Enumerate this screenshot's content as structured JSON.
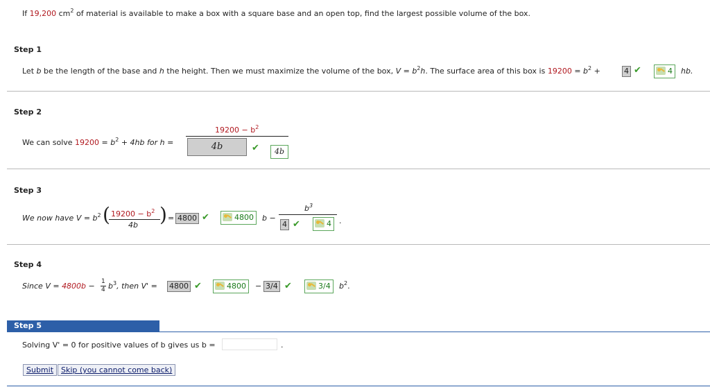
{
  "question": {
    "pre": "If ",
    "amount": "19,200",
    "unit": " cm",
    "unit_exp": "2",
    "post": " of material is available to make a box with a square base and an open top, find the largest possible volume of the box."
  },
  "step1": {
    "label": "Step 1",
    "text_a": "Let ",
    "var_b": "b",
    "text_b": " be the length of the base and ",
    "var_h": "h",
    "text_c": " the height. Then we must maximize the volume of the box, ",
    "volume_eq": "V = b",
    "volume_exp": "2",
    "volume_h": "h",
    "text_d": ". The surface area of this box is ",
    "area_eq": "19200",
    "area_mid": " = b",
    "area_exp": "2",
    "area_plus": " +",
    "answer_box": "4",
    "key_value": "4",
    "tail": "hb."
  },
  "step2": {
    "label": "Step 2",
    "text_a": "We can solve ",
    "eq_lhs": "19200",
    "eq_rest": " = b",
    "eq_exp": "2",
    "eq_tail": " + 4hb  for  h = ",
    "num": "19200 − b",
    "num_exp": "2",
    "answer_box": "4b",
    "key_value": "4b"
  },
  "step3": {
    "label": "Step 3",
    "text_a": "We now have  V = b",
    "exp_a": "2",
    "inner_num": "19200 − b",
    "inner_exp": "2",
    "inner_den": "4b",
    "equals": "=",
    "box_a": "4800",
    "key_a": "4800",
    "b_minus": "b −",
    "frac_num": "b",
    "frac_num_exp": "3",
    "box_b": "4",
    "key_b": "4",
    "period": "."
  },
  "step4": {
    "label": "Step 4",
    "text_a": "Since  V = ",
    "v_expr": "4800b",
    "minus": " −",
    "frac_n": "1",
    "frac_d": "4",
    "b3": "b",
    "b3_exp": "3",
    "then": ",  then  V' = ",
    "box_a": "4800",
    "key_a": "4800",
    "minus2": "−",
    "box_b": "3/4",
    "key_b": "3/4",
    "tail": "b",
    "tail_exp": "2",
    "tail_end": "."
  },
  "step5": {
    "label": "Step 5",
    "text": "Solving V' = 0 for positive values of b gives us b = ",
    "input_value": "",
    "period": ".",
    "submit_label": "Submit",
    "skip_label": "Skip (you cannot come back)"
  }
}
